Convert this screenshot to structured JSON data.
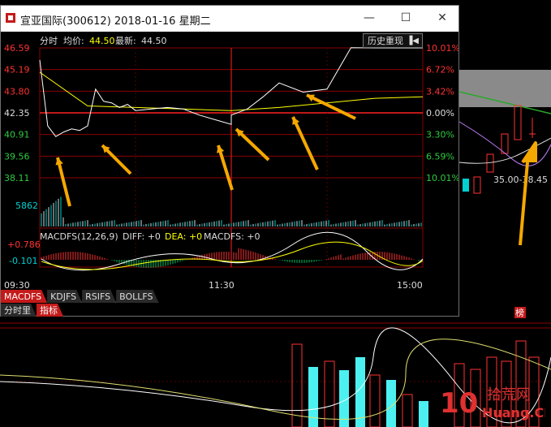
{
  "window": {
    "title": "宣亚国际(300612) 2018-01-16 星期二",
    "minimize": "—",
    "maximize": "☐",
    "close": "✕"
  },
  "header": {
    "mode": "分时",
    "avg_label": "均价:",
    "avg_value": "44.50",
    "last_label": "最新:",
    "last_value": "44.50",
    "history_button": "历史重现"
  },
  "price_axis": [
    "46.59",
    "45.19",
    "43.80",
    "42.35",
    "40.91",
    "39.56",
    "38.11"
  ],
  "pct_axis": [
    "10.01%",
    "6.72%",
    "3.42%",
    "0.00%",
    "3.30%",
    "6.59%",
    "10.01%"
  ],
  "volume_label": "5862",
  "macd": {
    "title": "MACDFS(12,26,9)",
    "diff": "DIFF: +0",
    "dea": "DEA: +0",
    "macdfs": "MACDFS: +0",
    "top": "+0.786",
    "bottom": "-0.101"
  },
  "time_axis": [
    "09:30",
    "11:30",
    "15:00"
  ],
  "indicator_tabs": [
    "MACDFS",
    "KDJFS",
    "RSIFS",
    "BOLLFS"
  ],
  "bottom_tabs": [
    "分时里",
    "指标"
  ],
  "bg": {
    "price_note": "35.00-38.45",
    "board_label": "榜",
    "watermark_num": "10",
    "watermark_cn": "拾荒网",
    "watermark_en": "Huang.CN"
  },
  "colors": {
    "price_line": "#ffffff",
    "avg_line": "#ffff00",
    "up": "#ff3232",
    "down": "#00d0d0",
    "arrow": "#f5a800",
    "grid": "#8b0000"
  },
  "chart_data": {
    "type": "line",
    "series": [
      {
        "name": "最新",
        "x": [
          "09:30",
          "09:35",
          "09:40",
          "09:45",
          "09:50",
          "09:55",
          "10:00",
          "10:05",
          "10:10",
          "10:15",
          "10:20",
          "10:25",
          "10:30",
          "10:40",
          "10:50",
          "11:00",
          "11:10",
          "11:20",
          "11:30",
          "13:00",
          "13:10",
          "13:20",
          "13:30",
          "13:45",
          "14:00",
          "14:15",
          "14:30",
          "14:45",
          "15:00"
        ],
        "values": [
          45.8,
          41.5,
          40.8,
          41.1,
          41.3,
          41.2,
          41.5,
          43.9,
          43.1,
          43.0,
          42.7,
          42.9,
          42.5,
          42.6,
          42.7,
          42.6,
          42.2,
          41.9,
          41.6,
          42.2,
          42.6,
          43.4,
          44.3,
          43.7,
          43.9,
          46.6,
          46.59,
          46.59,
          46.59
        ]
      },
      {
        "name": "均价",
        "x": [
          "09:30",
          "10:00",
          "10:30",
          "11:00",
          "11:30",
          "13:00",
          "13:30",
          "14:00",
          "14:30",
          "15:00"
        ],
        "values": [
          45.0,
          42.8,
          42.7,
          42.6,
          42.5,
          42.5,
          42.7,
          43.0,
          43.3,
          43.4
        ]
      }
    ],
    "ylim": [
      38.11,
      46.59
    ],
    "prev_close": 42.35
  }
}
